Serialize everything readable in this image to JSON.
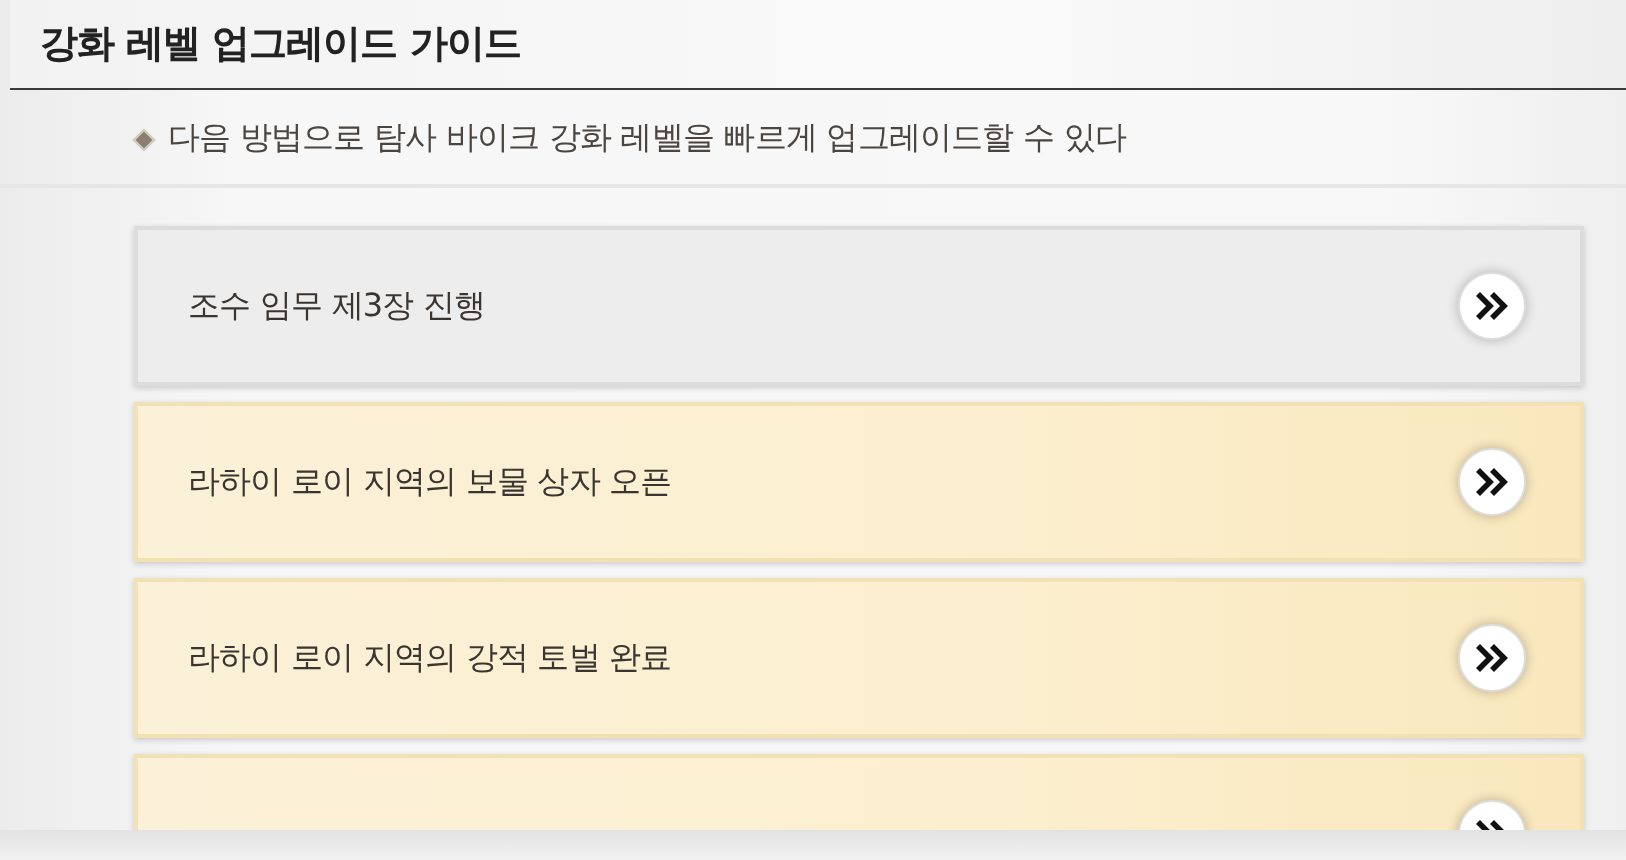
{
  "header": {
    "title": "강화 레벨 업그레이드 가이드"
  },
  "intro": {
    "text": "다음 방법으로 탐사 바이크 강화 레벨을 빠르게 업그레이드할 수 있다"
  },
  "methods": [
    {
      "label": "조수 임무 제3장 진행",
      "highlighted": false
    },
    {
      "label": "라하이 로이 지역의 보물 상자 오픈",
      "highlighted": true
    },
    {
      "label": "라하이 로이 지역의 강적 토벌 완료",
      "highlighted": true
    },
    {
      "highlighted": true
    }
  ]
}
